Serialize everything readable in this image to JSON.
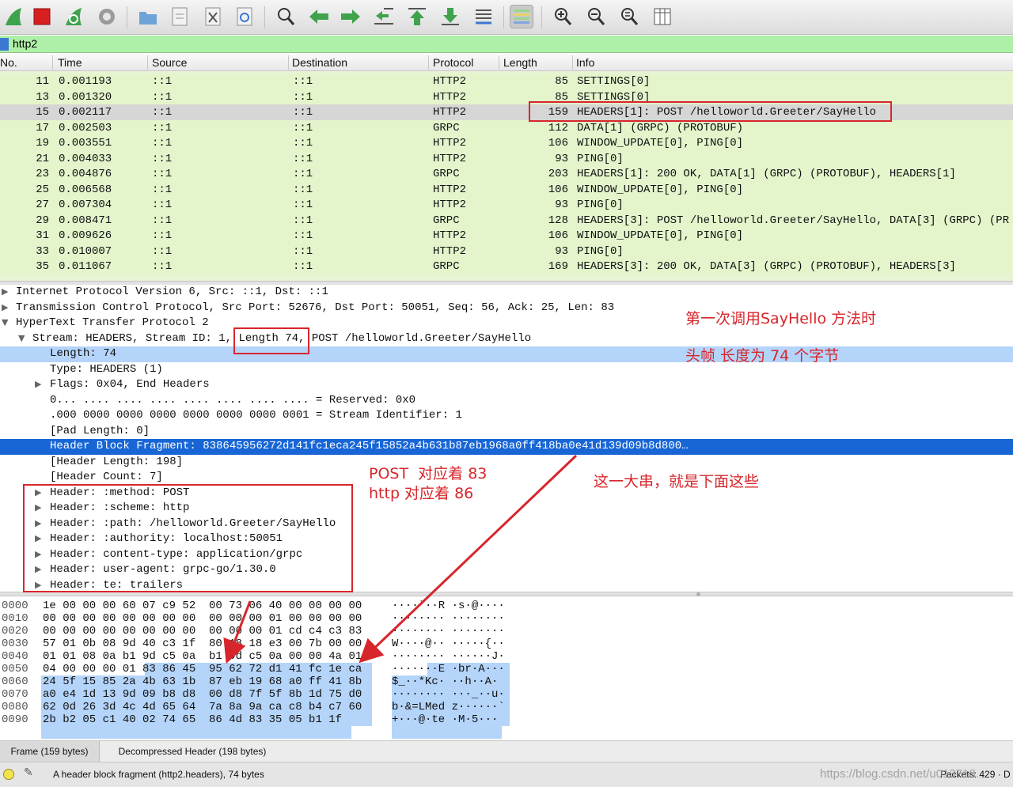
{
  "filter": {
    "value": "http2"
  },
  "packet_list": {
    "columns": [
      "No.",
      "Time",
      "Source",
      "Destination",
      "Protocol",
      "Length",
      "Info"
    ],
    "rows": [
      {
        "no": "11",
        "time": "0.001193",
        "src": "::1",
        "dst": "::1",
        "proto": "HTTP2",
        "len": "85",
        "info": "SETTINGS[0]"
      },
      {
        "no": "13",
        "time": "0.001320",
        "src": "::1",
        "dst": "::1",
        "proto": "HTTP2",
        "len": "85",
        "info": "SETTINGS[0]"
      },
      {
        "no": "15",
        "time": "0.002117",
        "src": "::1",
        "dst": "::1",
        "proto": "HTTP2",
        "len": "159",
        "info": "HEADERS[1]: POST /helloworld.Greeter/SayHello"
      },
      {
        "no": "17",
        "time": "0.002503",
        "src": "::1",
        "dst": "::1",
        "proto": "GRPC",
        "len": "112",
        "info": "DATA[1] (GRPC) (PROTOBUF)"
      },
      {
        "no": "19",
        "time": "0.003551",
        "src": "::1",
        "dst": "::1",
        "proto": "HTTP2",
        "len": "106",
        "info": "WINDOW_UPDATE[0], PING[0]"
      },
      {
        "no": "21",
        "time": "0.004033",
        "src": "::1",
        "dst": "::1",
        "proto": "HTTP2",
        "len": "93",
        "info": "PING[0]"
      },
      {
        "no": "23",
        "time": "0.004876",
        "src": "::1",
        "dst": "::1",
        "proto": "GRPC",
        "len": "203",
        "info": "HEADERS[1]: 200 OK, DATA[1] (GRPC) (PROTOBUF), HEADERS[1]"
      },
      {
        "no": "25",
        "time": "0.006568",
        "src": "::1",
        "dst": "::1",
        "proto": "HTTP2",
        "len": "106",
        "info": "WINDOW_UPDATE[0], PING[0]"
      },
      {
        "no": "27",
        "time": "0.007304",
        "src": "::1",
        "dst": "::1",
        "proto": "HTTP2",
        "len": "93",
        "info": "PING[0]"
      },
      {
        "no": "29",
        "time": "0.008471",
        "src": "::1",
        "dst": "::1",
        "proto": "GRPC",
        "len": "128",
        "info": "HEADERS[3]: POST /helloworld.Greeter/SayHello, DATA[3] (GRPC) (PR"
      },
      {
        "no": "31",
        "time": "0.009626",
        "src": "::1",
        "dst": "::1",
        "proto": "HTTP2",
        "len": "106",
        "info": "WINDOW_UPDATE[0], PING[0]"
      },
      {
        "no": "33",
        "time": "0.010007",
        "src": "::1",
        "dst": "::1",
        "proto": "HTTP2",
        "len": "93",
        "info": "PING[0]"
      },
      {
        "no": "35",
        "time": "0.011067",
        "src": "::1",
        "dst": "::1",
        "proto": "GRPC",
        "len": "169",
        "info": "HEADERS[3]: 200 OK, DATA[3] (GRPC) (PROTOBUF), HEADERS[3]"
      }
    ]
  },
  "detail": {
    "rows": [
      {
        "text": "Internet Protocol Version 6, Src: ::1, Dst: ::1",
        "arrow": "▶"
      },
      {
        "text": "Transmission Control Protocol, Src Port: 52676, Dst Port: 50051, Seq: 56, Ack: 25, Len: 83",
        "arrow": "▶"
      },
      {
        "text": "HyperText Transfer Protocol 2",
        "arrow": "▼"
      },
      {
        "text": "Stream: HEADERS, Stream ID: 1, Length 74, POST /helloworld.Greeter/SayHello",
        "arrow": "▼"
      },
      {
        "text": "Length: 74",
        "arrow": ""
      },
      {
        "text": "Type: HEADERS (1)",
        "arrow": ""
      },
      {
        "text": "Flags: 0x04, End Headers",
        "arrow": "▶"
      },
      {
        "text": "0... .... .... .... .... .... .... .... = Reserved: 0x0",
        "arrow": ""
      },
      {
        "text": ".000 0000 0000 0000 0000 0000 0000 0001 = Stream Identifier: 1",
        "arrow": ""
      },
      {
        "text": "[Pad Length: 0]",
        "arrow": ""
      },
      {
        "text": "Header Block Fragment: 838645956272d141fc1eca245f15852a4b631b87eb1968a0ff418ba0e41d139d09b8d800…",
        "arrow": ""
      },
      {
        "text": "[Header Length: 198]",
        "arrow": ""
      },
      {
        "text": "[Header Count: 7]",
        "arrow": ""
      },
      {
        "text": "Header: :method: POST",
        "arrow": "▶"
      },
      {
        "text": "Header: :scheme: http",
        "arrow": "▶"
      },
      {
        "text": "Header: :path: /helloworld.Greeter/SayHello",
        "arrow": "▶"
      },
      {
        "text": "Header: :authority: localhost:50051",
        "arrow": "▶"
      },
      {
        "text": "Header: content-type: application/grpc",
        "arrow": "▶"
      },
      {
        "text": "Header: user-agent: grpc-go/1.30.0",
        "arrow": "▶"
      },
      {
        "text": "Header: te: trailers",
        "arrow": "▶"
      }
    ]
  },
  "bytes": {
    "rows": [
      {
        "off": "0000",
        "hex": "1e 00 00 00 60 07 c9 52  00 73 06 40 00 00 00 00",
        "asc": "····`··R ·s·@····"
      },
      {
        "off": "0010",
        "hex": "00 00 00 00 00 00 00 00  00 00 00 01 00 00 00 00",
        "asc": "········ ········"
      },
      {
        "off": "0020",
        "hex": "00 00 00 00 00 00 00 00  00 00 00 01 cd c4 c3 83",
        "asc": "········ ········"
      },
      {
        "off": "0030",
        "hex": "57 01 0b 08 9d 40 c3 1f  80 18 18 e3 00 7b 00 00",
        "asc": "W····@·· ·····{··"
      },
      {
        "off": "0040",
        "hex": "01 01 08 0a b1 9d c5 0a  b1 9d c5 0a 00 00 4a 01",
        "asc": "········ ······J·"
      },
      {
        "off": "0050",
        "hex": "04 00 00 00 01 83 86 45  95 62 72 d1 41 fc 1e ca",
        "asc": "·······E ·br·A···"
      },
      {
        "off": "0060",
        "hex": "24 5f 15 85 2a 4b 63 1b  87 eb 19 68 a0 ff 41 8b",
        "asc": "$_··*Kc· ··h··A·"
      },
      {
        "off": "0070",
        "hex": "a0 e4 1d 13 9d 09 b8 d8  00 d8 7f 5f 8b 1d 75 d0",
        "asc": "········ ···_··u·"
      },
      {
        "off": "0080",
        "hex": "62 0d 26 3d 4c 4d 65 64  7a 8a 9a ca c8 b4 c7 60",
        "asc": "b·&=LMed z······`"
      },
      {
        "off": "0090",
        "hex": "2b b2 05 c1 40 02 74 65  86 4d 83 35 05 b1 1f",
        "asc": "+···@·te ·M·5···"
      }
    ]
  },
  "tabs": [
    "Frame (159 bytes)",
    "Decompressed Header (198 bytes)"
  ],
  "status": {
    "message": "A header block fragment (http2.headers), 74 bytes",
    "packets": "Packets: 429 · D",
    "watermark": "https://blog.csdn.net/u013718..."
  },
  "annotations": {
    "a1": "第一次调用SayHello 方法时",
    "a2": "头帧 长度为 74 个字节",
    "a3": "POST  对应着 83\nhttp 对应着 86",
    "a4": "这一大串，就是下面这些"
  },
  "colors": {
    "accent_red": "#d7262b",
    "selection_blue": "#1866d6",
    "row_green": "#e4f5cc",
    "filter_green": "#aff0a8",
    "byte_highlight": "#b4d4fa"
  },
  "toolbar_icons": [
    "shark-fin-start-icon",
    "stop-square-icon",
    "restart-fin-icon",
    "options-gear-icon",
    "open-folder-icon",
    "save-file-icon",
    "close-file-icon",
    "reload-icon",
    "find-magnifier-icon",
    "back-arrow-icon",
    "forward-arrow-icon",
    "go-to-packet-icon",
    "first-packet-icon",
    "last-packet-icon",
    "autoscroll-icon",
    "colorize-icon",
    "zoom-in-icon",
    "zoom-out-icon",
    "zoom-reset-icon",
    "resize-columns-icon"
  ]
}
